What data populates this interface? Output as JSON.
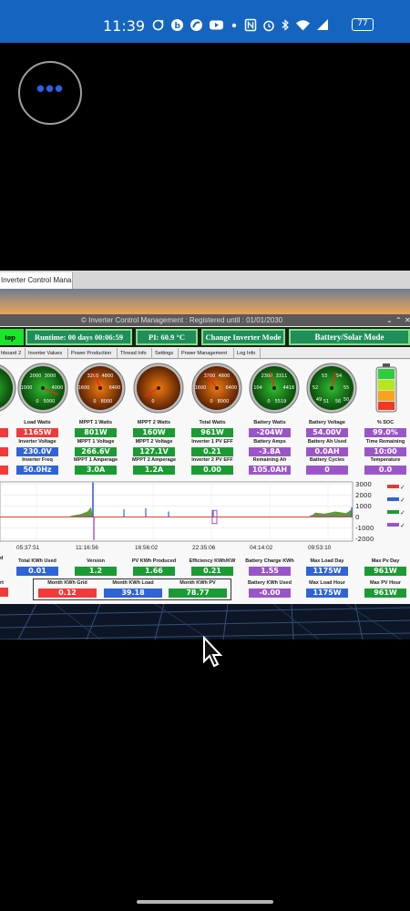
{
  "status_bar": {
    "time": "11:39",
    "battery": "77"
  },
  "floating_bubble": {
    "dots": "•••"
  },
  "window": {
    "tab_title": "Inverter Control Mana...",
    "title": "© Inverter Control Management : Registered until : 01/01/2030",
    "buttons": {
      "stop": "top",
      "runtime": "Runtime: 00 days 00:06:59",
      "pi_temp": "PI: 60.9 °C",
      "change_mode": "Change Inverter Mode",
      "mode": "Battery/Solar Mode"
    },
    "nav_tabs": [
      "hboard 2",
      "Inverter Values",
      "Power Production",
      "Thread Info",
      "Settings",
      "Power Management",
      "Log Info"
    ]
  },
  "gauges": [
    {
      "id": "g0",
      "face": "green",
      "ticks": [],
      "needle": 0.55
    },
    {
      "id": "g1",
      "face": "green",
      "ticks": [
        "2000",
        "3000",
        "1000",
        "4000",
        "0",
        "5000"
      ],
      "needle": 0.92
    },
    {
      "id": "g2",
      "face": "orange",
      "ticks": [
        "3200",
        "4800",
        "1600",
        "6400",
        "0",
        "8000"
      ],
      "needle": 0.42
    },
    {
      "id": "g3",
      "face": "orange",
      "ticks": [
        "",
        "",
        "",
        "",
        "0",
        ""
      ],
      "needle": 0.05
    },
    {
      "id": "g4",
      "face": "orange",
      "ticks": [
        "3200",
        "4800",
        "1600",
        "6400",
        "0",
        "8000"
      ],
      "needle": 0.36
    },
    {
      "id": "g5",
      "face": "green",
      "ticks": [
        "2308",
        "3311",
        "104",
        "4416",
        "0",
        "5519"
      ],
      "needle": 0.45
    },
    {
      "id": "g6",
      "face": "green",
      "ticks": [
        "53",
        "54",
        "52",
        "55",
        "51",
        "56",
        "49",
        "50"
      ],
      "needle": 0.55
    }
  ],
  "metrics_row1": [
    {
      "label": "Load Watts",
      "value": "1165W",
      "color": "red"
    },
    {
      "label": "MPPT 1 Watts",
      "value": "801W",
      "color": "green"
    },
    {
      "label": "MPPT 2 Watts",
      "value": "160W",
      "color": "green"
    },
    {
      "label": "Total Watts",
      "value": "961W",
      "color": "green"
    },
    {
      "label": "Battery Watts",
      "value": "-204W",
      "color": "purple"
    },
    {
      "label": "Battery Voltage",
      "value": "54.00V",
      "color": "purple"
    },
    {
      "label": "% SOC",
      "value": "99.0%",
      "color": "purple"
    }
  ],
  "metrics_row2": [
    {
      "label": "Inverter Voltage",
      "value": "230.0V",
      "color": "blue"
    },
    {
      "label": "MPPT 1 Voltage",
      "value": "266.6V",
      "color": "green"
    },
    {
      "label": "MPPT 2 Voltage",
      "value": "127.1V",
      "color": "green"
    },
    {
      "label": "Inverter 1 PV EFF",
      "value": "0.21",
      "color": "green"
    },
    {
      "label": "Battery Amps",
      "value": "-3.8A",
      "color": "purple"
    },
    {
      "label": "Battery Ah Used",
      "value": "0.0AH",
      "color": "purple"
    },
    {
      "label": "Time Remaining",
      "value": "10:00",
      "color": "purple"
    }
  ],
  "metrics_row3": [
    {
      "label": "Inverter Freq",
      "value": "50.0Hz",
      "color": "blue"
    },
    {
      "label": "MPPT 1 Amperage",
      "value": "3.0A",
      "color": "green"
    },
    {
      "label": "MPPT 2 Amperage",
      "value": "1.2A",
      "color": "green"
    },
    {
      "label": "Inverter 2 PV EFF",
      "value": "0.00",
      "color": "green"
    },
    {
      "label": "Remaining Ah",
      "value": "105.0AH",
      "color": "purple"
    },
    {
      "label": "Battery Cycles",
      "value": "0",
      "color": "purple"
    },
    {
      "label": "Temperature",
      "value": "0.0",
      "color": "purple"
    }
  ],
  "chart_data": {
    "type": "line",
    "x_ticks": [
      "05:37:51",
      "11:16:56",
      "16:56:02",
      "22:35:06",
      "04:14:02",
      "09:53:10"
    ],
    "y_ticks": [
      "3000",
      "2000",
      "1000",
      "0",
      "-1000",
      "-2000"
    ],
    "ylim": [
      -2200,
      3200
    ],
    "legend_colors": [
      "#e53935",
      "#2f63d8",
      "#1c9a34",
      "#9a56c8"
    ],
    "grid": true,
    "legend_placement": "right"
  },
  "bottom_row": {
    "left_labels": [
      "d",
      "rt"
    ],
    "items": [
      {
        "label": "Total KWh Used",
        "value": "0.01",
        "color": "blue"
      },
      {
        "label": "Version",
        "value": "1.2",
        "color": "green"
      },
      {
        "label": "PV KWh Produced",
        "value": "1.66",
        "color": "green"
      },
      {
        "label": "Efficiency KWh/KW",
        "value": "0.21",
        "color": "green"
      },
      {
        "label": "Battery Charge KWh",
        "value": "1.55",
        "color": "purple"
      },
      {
        "label": "Max Load Day",
        "value": "1175W",
        "color": "blue"
      },
      {
        "label": "Max Pv Day",
        "value": "961W",
        "color": "green"
      }
    ],
    "items2": [
      {
        "label": "Month KWh Grid",
        "value": "0.12",
        "color": "red"
      },
      {
        "label": "Month KWh Load",
        "value": "39.18",
        "color": "blue"
      },
      {
        "label": "Month KWh PV",
        "value": "78.77",
        "color": "green"
      },
      {
        "label": "Battery KWh Used",
        "value": "-0.00",
        "color": "purple"
      },
      {
        "label": "Max Load Hour",
        "value": "1175W",
        "color": "blue"
      },
      {
        "label": "Max PV Hour",
        "value": "961W",
        "color": "green"
      }
    ]
  }
}
